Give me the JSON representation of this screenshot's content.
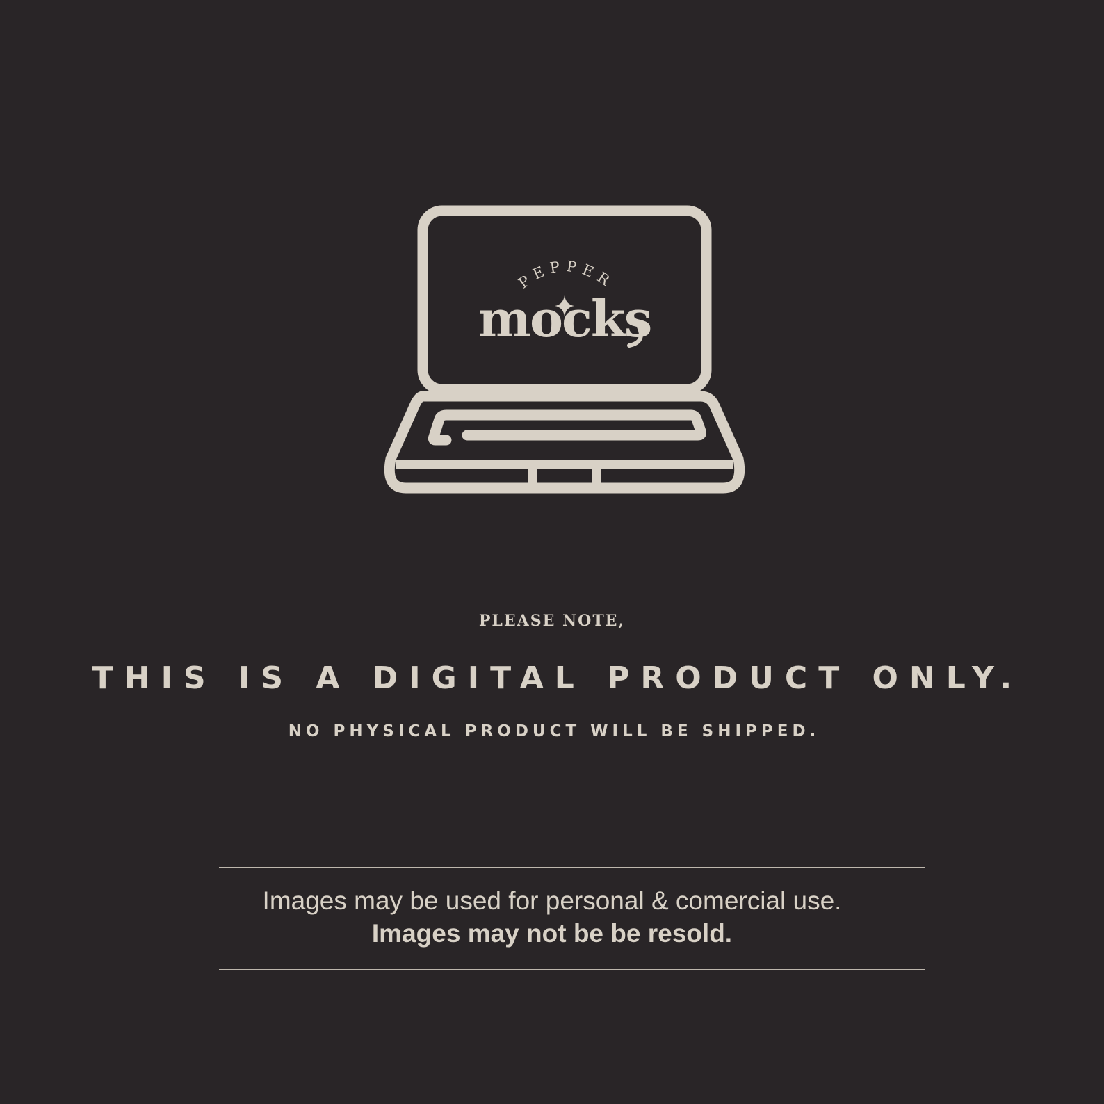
{
  "brand": {
    "arc_text": "PEPPER",
    "word": "mocks"
  },
  "notice": {
    "label": "PLEASE NOTE,",
    "headline": "THIS IS A DIGITAL PRODUCT ONLY.",
    "subline": "NO PHYSICAL PRODUCT WILL BE SHIPPED."
  },
  "usage": {
    "line1": "Images may be used for personal & comercial use.",
    "line2": "Images may not be be resold."
  },
  "icons": {
    "laptop": "laptop-icon",
    "sparkle": "sparkle-icon"
  },
  "colors": {
    "background": "#292527",
    "foreground": "#d8d1c6"
  }
}
